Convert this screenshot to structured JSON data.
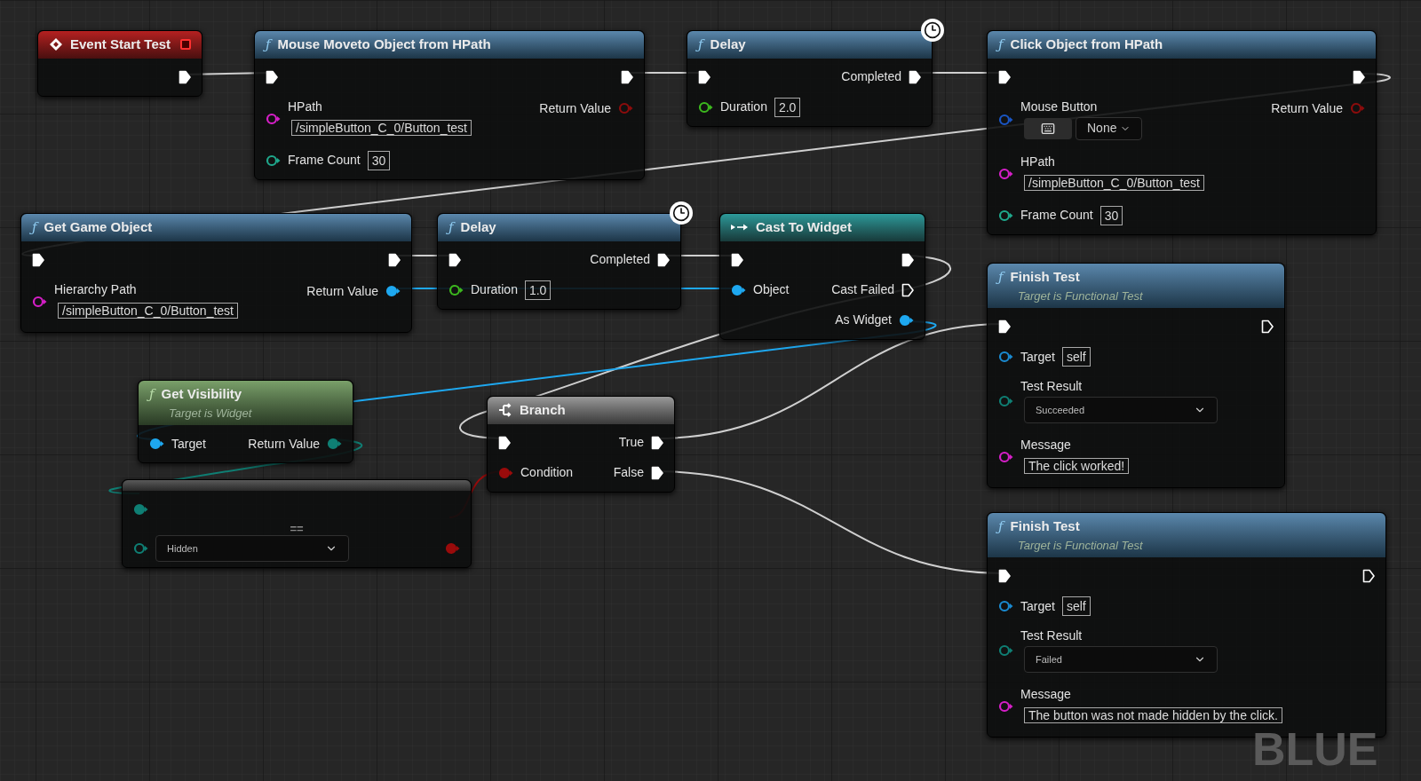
{
  "graph_label": "BLUE",
  "nodes": [
    {
      "kind": "event",
      "title": "Event Start Test",
      "rows": [
        {
          "right": {
            "kind": "exec",
            "connected": true
          }
        }
      ]
    },
    {
      "kind": "function",
      "glyph": "ƒ",
      "title": "Mouse Moveto Object from HPath",
      "rows": [
        {
          "left": {
            "kind": "exec",
            "connected": true
          },
          "right": {
            "kind": "exec",
            "connected": true
          }
        },
        {
          "left": {
            "kind": "data",
            "connected": false,
            "color": "#d61fc8",
            "label": "HPath",
            "field": {
              "kind": "text",
              "value": "/simpleButton_C_0/Button_test"
            }
          },
          "right": {
            "kind": "data",
            "connected": false,
            "color": "#8c0c0c",
            "label": "Return Value"
          }
        },
        {
          "left": {
            "kind": "data",
            "connected": false,
            "color": "#1fa88c",
            "label": "Frame Count",
            "field": {
              "kind": "inline_text",
              "value": "30"
            }
          }
        }
      ]
    },
    {
      "kind": "function",
      "glyph": "ƒ",
      "title": "Delay",
      "latent": true,
      "rows": [
        {
          "left": {
            "kind": "exec",
            "connected": true
          },
          "right": {
            "kind": "exec",
            "connected": true,
            "label": "Completed"
          }
        },
        {
          "left": {
            "kind": "data",
            "connected": false,
            "color": "#3cb81e",
            "label": "Duration",
            "field": {
              "kind": "inline_text",
              "value": "2.0"
            }
          }
        }
      ]
    },
    {
      "kind": "function",
      "glyph": "ƒ",
      "title": "Click Object from HPath",
      "rows": [
        {
          "left": {
            "kind": "exec",
            "connected": true
          },
          "right": {
            "kind": "exec",
            "connected": true
          }
        },
        {
          "left": {
            "kind": "data",
            "connected": false,
            "color": "#1a56c4",
            "label": "Mouse Button",
            "field": {
              "kind": "key_dropdown",
              "value": "None"
            }
          },
          "right": {
            "kind": "data",
            "connected": false,
            "color": "#8c0c0c",
            "label": "Return Value"
          }
        },
        {
          "left": {
            "kind": "data",
            "connected": false,
            "color": "#d61fc8",
            "label": "HPath",
            "field": {
              "kind": "text",
              "value": "/simpleButton_C_0/Button_test"
            }
          }
        },
        {
          "left": {
            "kind": "data",
            "connected": false,
            "color": "#1fa88c",
            "label": "Frame Count",
            "field": {
              "kind": "inline_text",
              "value": "30"
            }
          }
        }
      ]
    },
    {
      "kind": "function",
      "glyph": "ƒ",
      "title": "Get Game Object",
      "rows": [
        {
          "left": {
            "kind": "exec",
            "connected": true
          },
          "right": {
            "kind": "exec",
            "connected": true
          }
        },
        {
          "left": {
            "kind": "data",
            "connected": false,
            "color": "#d61fc8",
            "label": "Hierarchy Path",
            "field": {
              "kind": "text",
              "value": "/simpleButton_C_0/Button_test"
            }
          },
          "right": {
            "kind": "data",
            "connected": true,
            "color": "#1ea8f0",
            "label": "Return Value"
          }
        }
      ]
    },
    {
      "kind": "function",
      "glyph": "ƒ",
      "title": "Delay",
      "latent": true,
      "rows": [
        {
          "left": {
            "kind": "exec",
            "connected": true
          },
          "right": {
            "kind": "exec",
            "connected": true,
            "label": "Completed"
          }
        },
        {
          "left": {
            "kind": "data",
            "connected": false,
            "color": "#3cb81e",
            "label": "Duration",
            "field": {
              "kind": "inline_text",
              "value": "1.0"
            }
          }
        }
      ]
    },
    {
      "kind": "cast",
      "title": "Cast To Widget",
      "rows": [
        {
          "left": {
            "kind": "exec",
            "connected": true
          },
          "right": {
            "kind": "exec",
            "connected": true
          }
        },
        {
          "left": {
            "kind": "data",
            "connected": true,
            "color": "#1ea8f0",
            "label": "Object"
          },
          "right": {
            "kind": "exec",
            "connected": false,
            "label": "Cast Failed"
          }
        },
        {
          "right": {
            "kind": "data",
            "connected": true,
            "color": "#1ea8f0",
            "label": "As Widget"
          }
        }
      ]
    },
    {
      "kind": "pure",
      "glyph": "ƒ",
      "title": "Get Visibility",
      "subtitle": "Target is Widget",
      "rows": [
        {
          "left": {
            "kind": "data",
            "connected": true,
            "color": "#1ea8f0",
            "label": "Target"
          },
          "right": {
            "kind": "data",
            "connected": true,
            "color": "#0f7f74",
            "label": "Return Value"
          }
        }
      ]
    },
    {
      "kind": "compare",
      "title": "==",
      "rows": [
        {
          "left": {
            "kind": "data",
            "connected": true,
            "color": "#0f7f74"
          }
        },
        {
          "left": {
            "kind": "data",
            "connected": false,
            "color": "#0f7f74",
            "field": {
              "kind": "dropdown",
              "value": "Hidden"
            }
          },
          "right": {
            "kind": "data",
            "connected": true,
            "color": "#9a0b0b"
          }
        }
      ]
    },
    {
      "kind": "branch",
      "title": "Branch",
      "rows": [
        {
          "left": {
            "kind": "exec",
            "connected": true
          },
          "right": {
            "kind": "exec",
            "connected": true,
            "label": "True"
          }
        },
        {
          "left": {
            "kind": "data",
            "connected": true,
            "color": "#9a0b0b",
            "label": "Condition"
          },
          "right": {
            "kind": "exec",
            "connected": true,
            "label": "False"
          }
        }
      ]
    },
    {
      "kind": "function",
      "glyph": "ƒ",
      "title": "Finish Test",
      "subtitle": "Target is Functional Test",
      "rows": [
        {
          "left": {
            "kind": "exec",
            "connected": true
          },
          "right": {
            "kind": "exec",
            "connected": false
          }
        },
        {
          "left": {
            "kind": "data",
            "connected": false,
            "color": "#1a8ad0",
            "label": "Target",
            "field": {
              "kind": "inline_text",
              "value": "self"
            }
          }
        },
        {
          "left": {
            "kind": "data",
            "connected": false,
            "color": "#0f7f74",
            "label": "Test Result",
            "field": {
              "kind": "dropdown",
              "value": "Succeeded"
            }
          }
        },
        {
          "left": {
            "kind": "data",
            "connected": false,
            "color": "#d61fc8",
            "label": "Message",
            "field": {
              "kind": "text",
              "value": "The click worked!"
            }
          }
        }
      ]
    },
    {
      "kind": "function",
      "glyph": "ƒ",
      "title": "Finish Test",
      "subtitle": "Target is Functional Test",
      "rows": [
        {
          "left": {
            "kind": "exec",
            "connected": true
          },
          "right": {
            "kind": "exec",
            "connected": false
          }
        },
        {
          "left": {
            "kind": "data",
            "connected": false,
            "color": "#1a8ad0",
            "label": "Target",
            "field": {
              "kind": "inline_text",
              "value": "self"
            }
          }
        },
        {
          "left": {
            "kind": "data",
            "connected": false,
            "color": "#0f7f74",
            "label": "Test Result",
            "field": {
              "kind": "dropdown",
              "value": "Failed"
            }
          }
        },
        {
          "left": {
            "kind": "data",
            "connected": false,
            "color": "#d61fc8",
            "label": "Message",
            "field": {
              "kind": "text",
              "value": "The button was not made hidden by the click."
            }
          }
        }
      ]
    }
  ]
}
